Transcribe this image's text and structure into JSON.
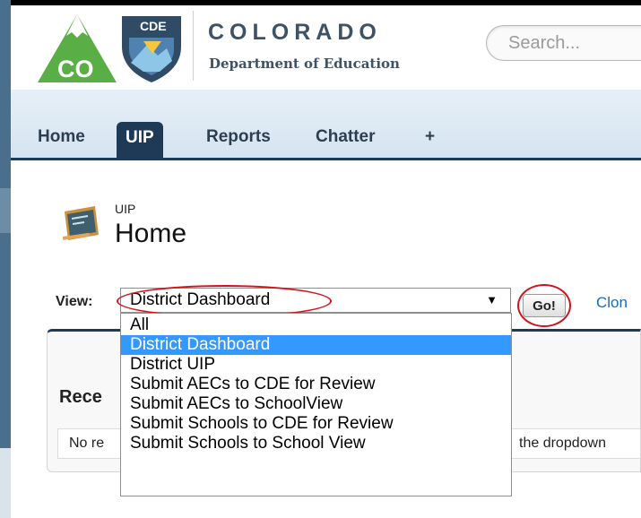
{
  "header": {
    "logo_text_top": "CDE",
    "logo_text_main": "CO",
    "brand_title": "COLORADO",
    "brand_subtitle": "Department of Education",
    "search_placeholder": "Search..."
  },
  "tabs": [
    {
      "label": "Home",
      "active": false
    },
    {
      "label": "UIP",
      "active": true
    },
    {
      "label": "Reports",
      "active": false
    },
    {
      "label": "Chatter",
      "active": false
    },
    {
      "label": "+",
      "active": false
    }
  ],
  "page": {
    "eyebrow": "UIP",
    "title": "Home"
  },
  "view": {
    "label": "View:",
    "selected": "District Dashboard",
    "options": [
      "All",
      "District Dashboard",
      "District UIP",
      "Submit AECs to CDE for Review",
      "Submit AECs to SchoolView",
      "Submit Schools to CDE for Review",
      "Submit Schools to School View"
    ],
    "go_label": "Go!",
    "clone_label": "Clon"
  },
  "recent": {
    "title": "Rece",
    "no_records_start": "No re",
    "no_records_end": "the dropdown"
  },
  "colors": {
    "tab_active": "#1f3a56",
    "highlight": "#3399ff",
    "annotation": "#d0141e",
    "link": "#1a6bb5"
  }
}
